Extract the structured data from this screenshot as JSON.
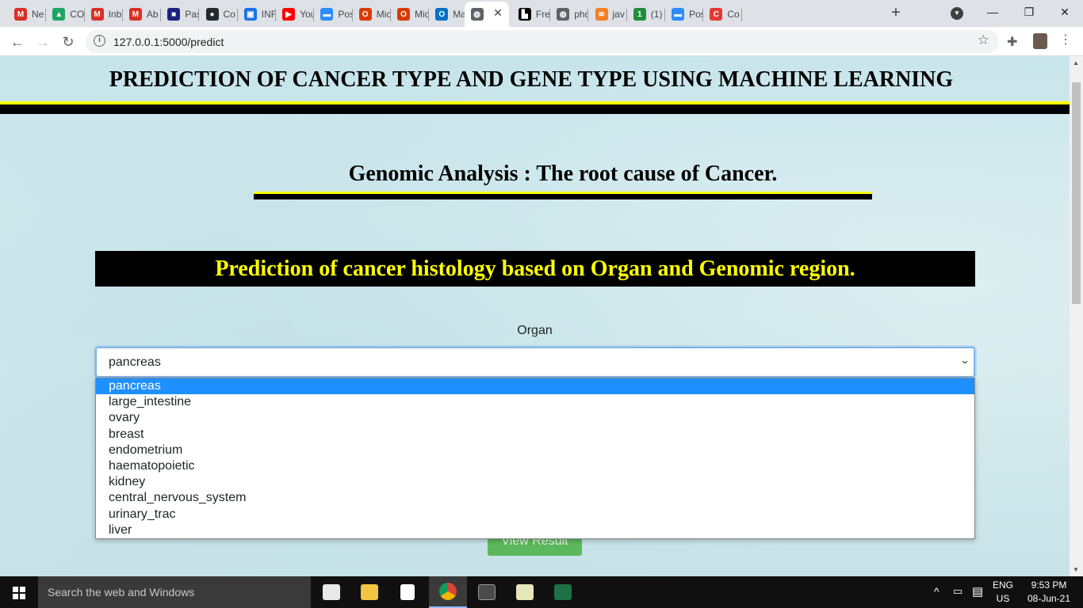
{
  "browser": {
    "tabs": [
      {
        "label": "Ne",
        "icon": "gmail-icon",
        "color": "#d93025",
        "glyph": "M"
      },
      {
        "label": "CO",
        "icon": "google-drive-icon",
        "color": "#1fa463",
        "glyph": "▲"
      },
      {
        "label": "Inb",
        "icon": "gmail-icon",
        "color": "#d93025",
        "glyph": "M"
      },
      {
        "label": "Ab",
        "icon": "gmail-icon",
        "color": "#d93025",
        "glyph": "M"
      },
      {
        "label": "Pas",
        "icon": "site-icon",
        "color": "#1a237e",
        "glyph": "■"
      },
      {
        "label": "Co",
        "icon": "github-icon",
        "color": "#24292e",
        "glyph": "●"
      },
      {
        "label": "INF",
        "icon": "contacts-icon",
        "color": "#1a73e8",
        "glyph": "▣"
      },
      {
        "label": "You",
        "icon": "youtube-icon",
        "color": "#ff0000",
        "glyph": "▶"
      },
      {
        "label": "Pos",
        "icon": "zoom-icon",
        "color": "#2d8cff",
        "glyph": "▬"
      },
      {
        "label": "Mic",
        "icon": "office-icon",
        "color": "#d83b01",
        "glyph": "O"
      },
      {
        "label": "Mic",
        "icon": "office-icon",
        "color": "#d83b01",
        "glyph": "O"
      },
      {
        "label": "Ma",
        "icon": "outlook-icon",
        "color": "#0072c6",
        "glyph": "O"
      },
      {
        "label": "",
        "icon": "globe-icon",
        "color": "#5f6368",
        "glyph": "◍"
      },
      {
        "label": "Fre",
        "icon": "site-icon",
        "color": "#000000",
        "glyph": "▙"
      },
      {
        "label": "phc",
        "icon": "globe-icon",
        "color": "#5f6368",
        "glyph": "◍"
      },
      {
        "label": "jav",
        "icon": "stackoverflow-icon",
        "color": "#f48024",
        "glyph": "≋"
      },
      {
        "label": "(1)",
        "icon": "notification-icon",
        "color": "#1e8e3e",
        "glyph": "1"
      },
      {
        "label": "Pos",
        "icon": "zoom-icon",
        "color": "#2d8cff",
        "glyph": "▬"
      },
      {
        "label": "Co",
        "icon": "site-icon",
        "color": "#e53935",
        "glyph": "C"
      }
    ],
    "active_tab_index": 12,
    "url": "127.0.0.1:5000/predict"
  },
  "page": {
    "main_title": "PREDICTION OF CANCER TYPE AND GENE TYPE USING MACHINE LEARNING",
    "subtitle": "Genomic Analysis : The root cause of Cancer.",
    "banner": "Prediction of cancer histology based on Organ and Genomic region.",
    "organ_label": "Organ",
    "organ_selected": "pancreas",
    "organ_options": [
      "pancreas",
      "large_intestine",
      "ovary",
      "breast",
      "endometrium",
      "haematopoietic",
      "kidney",
      "central_nervous_system",
      "urinary_trac",
      "liver"
    ],
    "view_button": "View Result"
  },
  "taskbar": {
    "search_placeholder": "Search the web and Windows",
    "language": "ENG",
    "region": "US",
    "time": "9:53 PM",
    "date": "08-Jun-21"
  }
}
